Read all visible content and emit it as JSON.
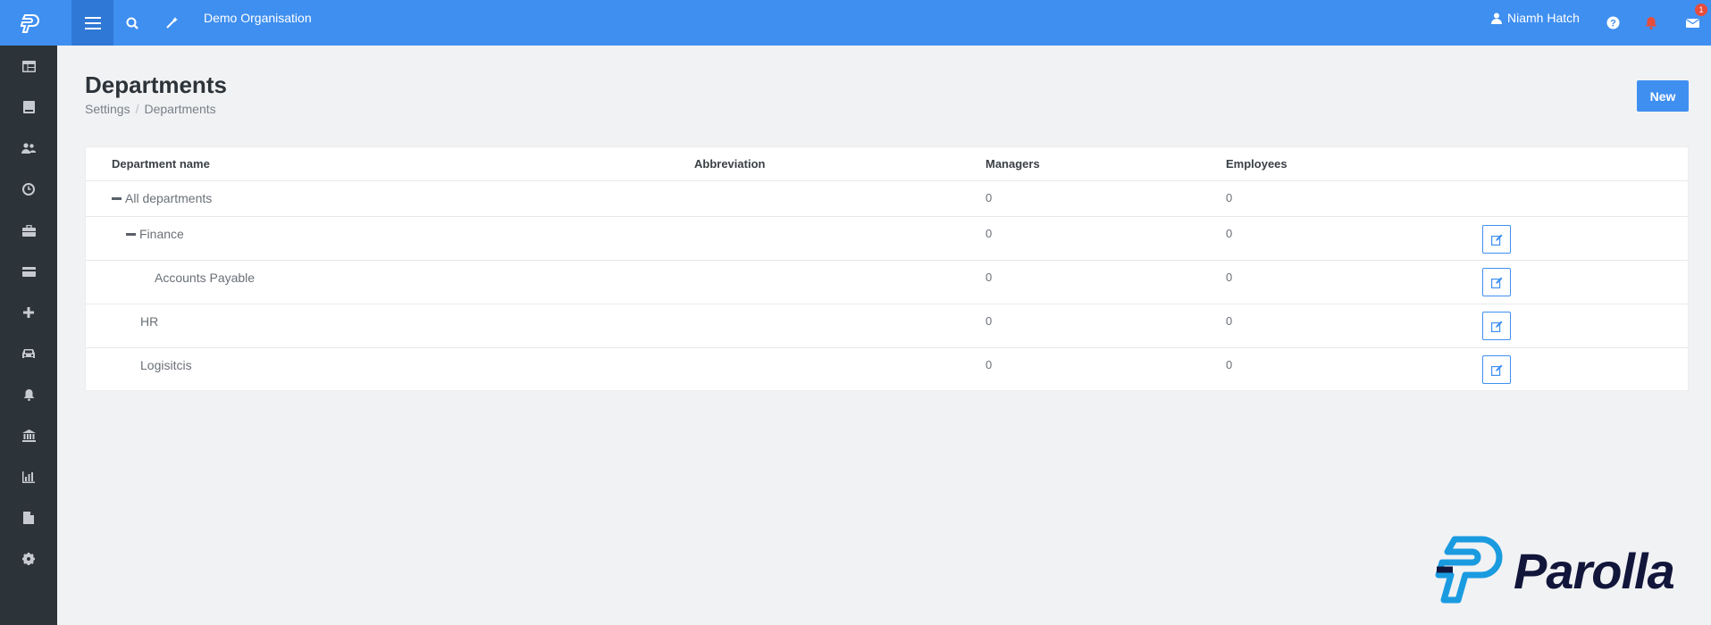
{
  "header": {
    "org_name": "Demo Organisation",
    "user_name": "Niamh Hatch",
    "mail_badge": "1",
    "icons": [
      "logo-icon",
      "menu-icon",
      "search-icon",
      "magic-wand-icon",
      "user-icon",
      "help-icon",
      "bell-icon",
      "envelope-icon"
    ]
  },
  "sidebar": {
    "items": [
      "dashboard-icon",
      "book-icon",
      "users-icon",
      "clock-icon",
      "briefcase-icon",
      "credit-card-icon",
      "plus-icon",
      "car-icon",
      "bell-icon",
      "bank-icon",
      "bar-chart-icon",
      "file-icon",
      "gear-icon"
    ]
  },
  "page": {
    "title": "Departments",
    "breadcrumb": [
      "Settings",
      "Departments"
    ],
    "new_label": "New"
  },
  "table": {
    "headers": {
      "name": "Department name",
      "abbreviation": "Abbreviation",
      "managers": "Managers",
      "employees": "Employees"
    },
    "rows": [
      {
        "name": "All departments",
        "abbreviation": "",
        "managers": "0",
        "employees": "0",
        "collapsible": true,
        "editable": false
      },
      {
        "name": "Finance",
        "abbreviation": "",
        "managers": "0",
        "employees": "0",
        "collapsible": true,
        "editable": true
      },
      {
        "name": "Accounts Payable",
        "abbreviation": "",
        "managers": "0",
        "employees": "0",
        "collapsible": false,
        "editable": true
      },
      {
        "name": "HR",
        "abbreviation": "",
        "managers": "0",
        "employees": "0",
        "collapsible": false,
        "editable": true
      },
      {
        "name": "Logisitcis",
        "abbreviation": "",
        "managers": "0",
        "employees": "0",
        "collapsible": false,
        "editable": true
      }
    ]
  },
  "brand": {
    "name": "Parolla"
  },
  "colors": {
    "primary": "#3f8ff0",
    "sidebar": "#2c3339",
    "background": "#f1f2f4",
    "brand_dark": "#12163b",
    "brand_light": "#1a9be0"
  }
}
